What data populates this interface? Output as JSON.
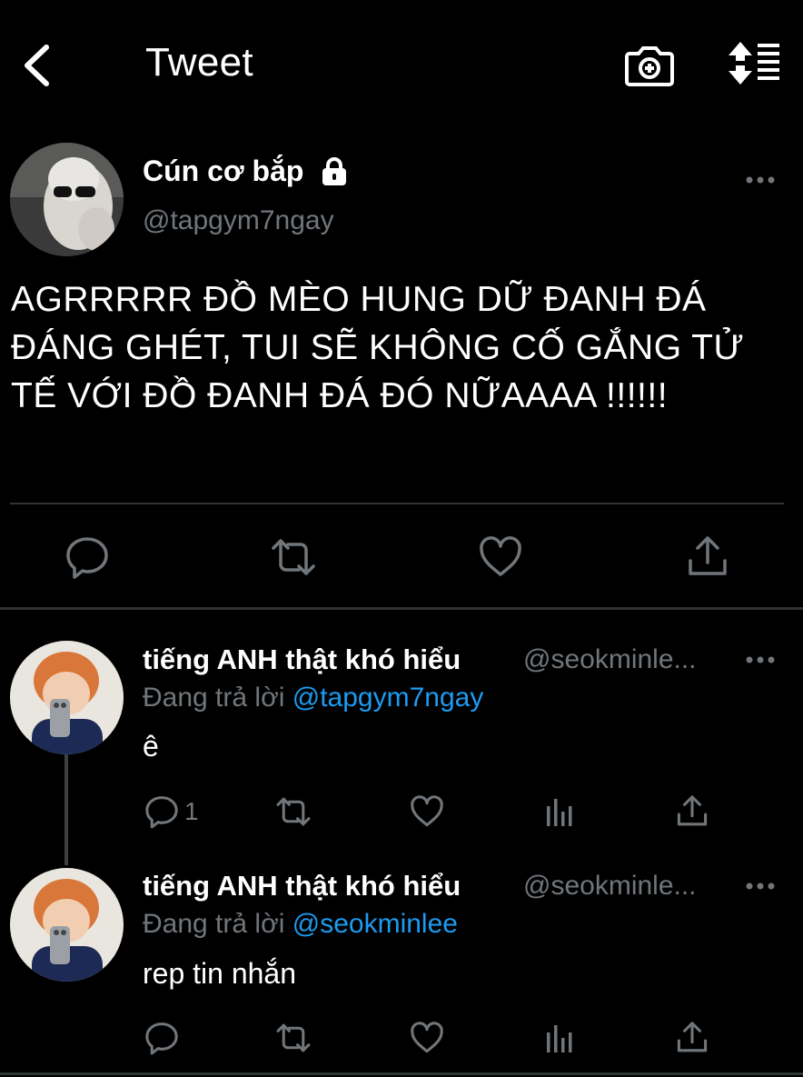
{
  "header": {
    "title": "Tweet",
    "icons": [
      "back-chevron-icon",
      "camera-plus-icon",
      "sort-icon"
    ]
  },
  "tweet": {
    "author_name": "Cún cơ bắp",
    "author_handle": "@tapgym7ngay",
    "locked": true,
    "text": "AGRRRRR ĐỒ MÈO HUNG DỮ ĐANH ĐÁ ĐÁNG GHÉT, TUI SẼ KHÔNG CỐ GẮNG TỬ TẾ VỚI ĐỒ ĐANH ĐÁ ĐÓ NỮAAAA !!!!!!",
    "actions": [
      "reply-icon",
      "retweet-icon",
      "like-icon",
      "share-icon"
    ]
  },
  "replies": [
    {
      "author_name": "tiếng ANH thật khó hiểu",
      "author_handle": "@seokminle...",
      "replying_label": "Đang trả lời",
      "replying_to": "@tapgym7ngay",
      "text": "ê",
      "reply_count": "1"
    },
    {
      "author_name": "tiếng ANH thật khó hiểu",
      "author_handle": "@seokminle...",
      "replying_label": "Đang trả lời",
      "replying_to": "@seokminlee",
      "text": "rep tin nhắn",
      "reply_count": ""
    }
  ],
  "colors": {
    "background": "#000000",
    "text": "#ffffff",
    "muted": "#71767b",
    "link": "#1d9bf0",
    "divider": "#2f3336"
  }
}
